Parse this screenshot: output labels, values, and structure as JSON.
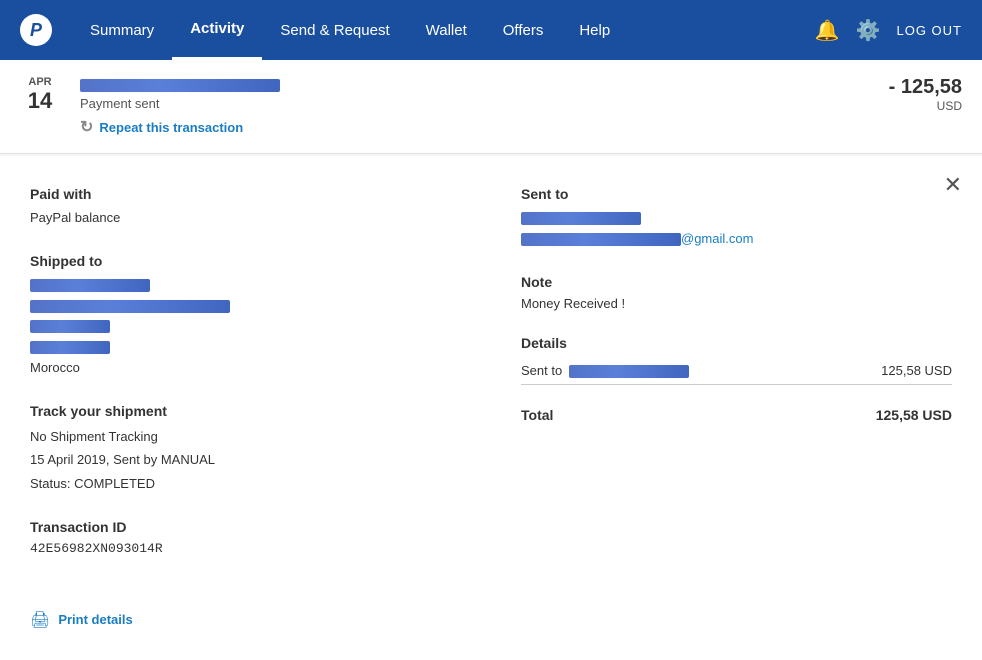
{
  "header": {
    "logo_text": "P",
    "nav_items": [
      {
        "id": "summary",
        "label": "Summary",
        "active": false
      },
      {
        "id": "activity",
        "label": "Activity",
        "active": true
      },
      {
        "id": "send_request",
        "label": "Send & Request",
        "active": false
      },
      {
        "id": "wallet",
        "label": "Wallet",
        "active": false
      },
      {
        "id": "offers",
        "label": "Offers",
        "active": false
      },
      {
        "id": "help",
        "label": "Help",
        "active": false
      }
    ],
    "logout_label": "LOG OUT"
  },
  "transaction": {
    "date_month": "APR",
    "date_day": "14",
    "status": "Payment sent",
    "repeat_label": "Repeat this transaction",
    "amount": "- 125,58",
    "currency": "USD"
  },
  "detail": {
    "paid_with_label": "Paid with",
    "paid_with_value": "PayPal balance",
    "shipped_to_label": "Shipped to",
    "shipped_to_country": "Morocco",
    "track_label": "Track your shipment",
    "track_no_tracking": "No Shipment Tracking",
    "track_date": "15 April 2019, Sent by MANUAL",
    "track_status": "Status: COMPLETED",
    "txid_label": "Transaction ID",
    "txid_value": "42E56982XN093014R",
    "sent_to_label": "Sent to",
    "email_label": "@gmail.com",
    "note_label": "Note",
    "note_value": "Money Received !",
    "details_label": "Details",
    "details_row_label": "Sent to",
    "details_row_amount": "125,58 USD",
    "total_label": "Total",
    "total_amount": "125,58 USD",
    "print_label": "Print details"
  },
  "colors": {
    "accent": "#1a7dc4",
    "header_bg": "#1a4fa0",
    "active_nav": "white"
  }
}
